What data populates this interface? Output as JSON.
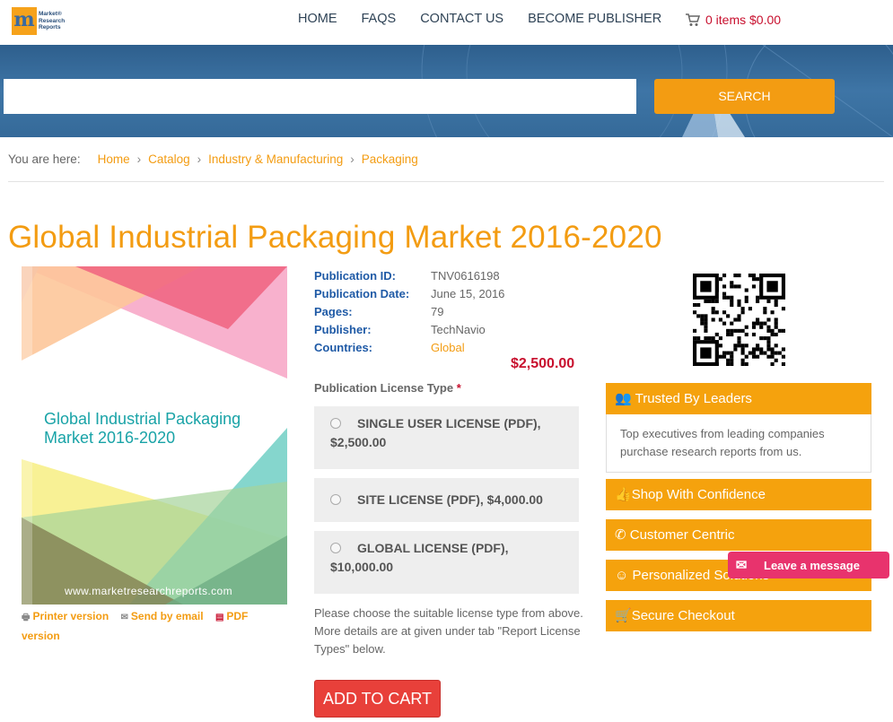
{
  "header": {
    "logo_letter": "m",
    "logo_text": [
      "Market®",
      "Research",
      "Reports"
    ],
    "nav": [
      "HOME",
      "FAQS",
      "CONTACT US",
      "BECOME PUBLISHER"
    ],
    "cart": "0 items $0.00"
  },
  "search": {
    "placeholder": "",
    "button": "SEARCH"
  },
  "breadcrumb": {
    "prefix": "You are here:",
    "items": [
      "Home",
      "Catalog",
      "Industry & Manufacturing",
      "Packaging"
    ]
  },
  "title": "Global Industrial Packaging Market 2016-2020",
  "cover": {
    "title_line1": "Global Industrial Packaging",
    "title_line2": "Market 2016-2020",
    "url": "www.marketresearchreports.com"
  },
  "links": {
    "printer": "Printer version",
    "email": "Send by email",
    "pdf_a": "PDF",
    "pdf_b": "version"
  },
  "meta": [
    {
      "key": "Publication ID:",
      "value": "TNV0616198"
    },
    {
      "key": "Publication Date:",
      "value": "June 15, 2016"
    },
    {
      "key": "Pages:",
      "value": "79"
    },
    {
      "key": "Publisher:",
      "value": "TechNavio"
    },
    {
      "key": "Countries:",
      "value": "Global"
    }
  ],
  "price": "$2,500.00",
  "license": {
    "label": "Publication License Type",
    "required": "*",
    "options": [
      {
        "l1": "SINGLE USER LICENSE (PDF),",
        "l2": "$2,500.00"
      },
      {
        "l1": "SITE LICENSE (PDF), $4,000.00",
        "l2": ""
      },
      {
        "l1": "GLOBAL LICENSE (PDF),",
        "l2": "$10,000.00"
      }
    ],
    "help": "Please choose the suitable license type from above. More details are at given under tab \"Report License Types\" below.",
    "add_to_cart": "ADD TO CART"
  },
  "sidebar": {
    "trusted_title": "Trusted By Leaders",
    "trusted_body": "Top executives from leading companies purchase research reports from us.",
    "items": [
      "Shop With Confidence",
      "Customer Centric",
      "Personalized Solutions",
      "Secure Checkout"
    ]
  },
  "chat": "Leave a message",
  "colors": {
    "accent": "#f39c12",
    "price": "#c8102e",
    "link_blue": "#1f5aa6",
    "cart_btn": "#e8403a",
    "chat": "#e8336d"
  }
}
